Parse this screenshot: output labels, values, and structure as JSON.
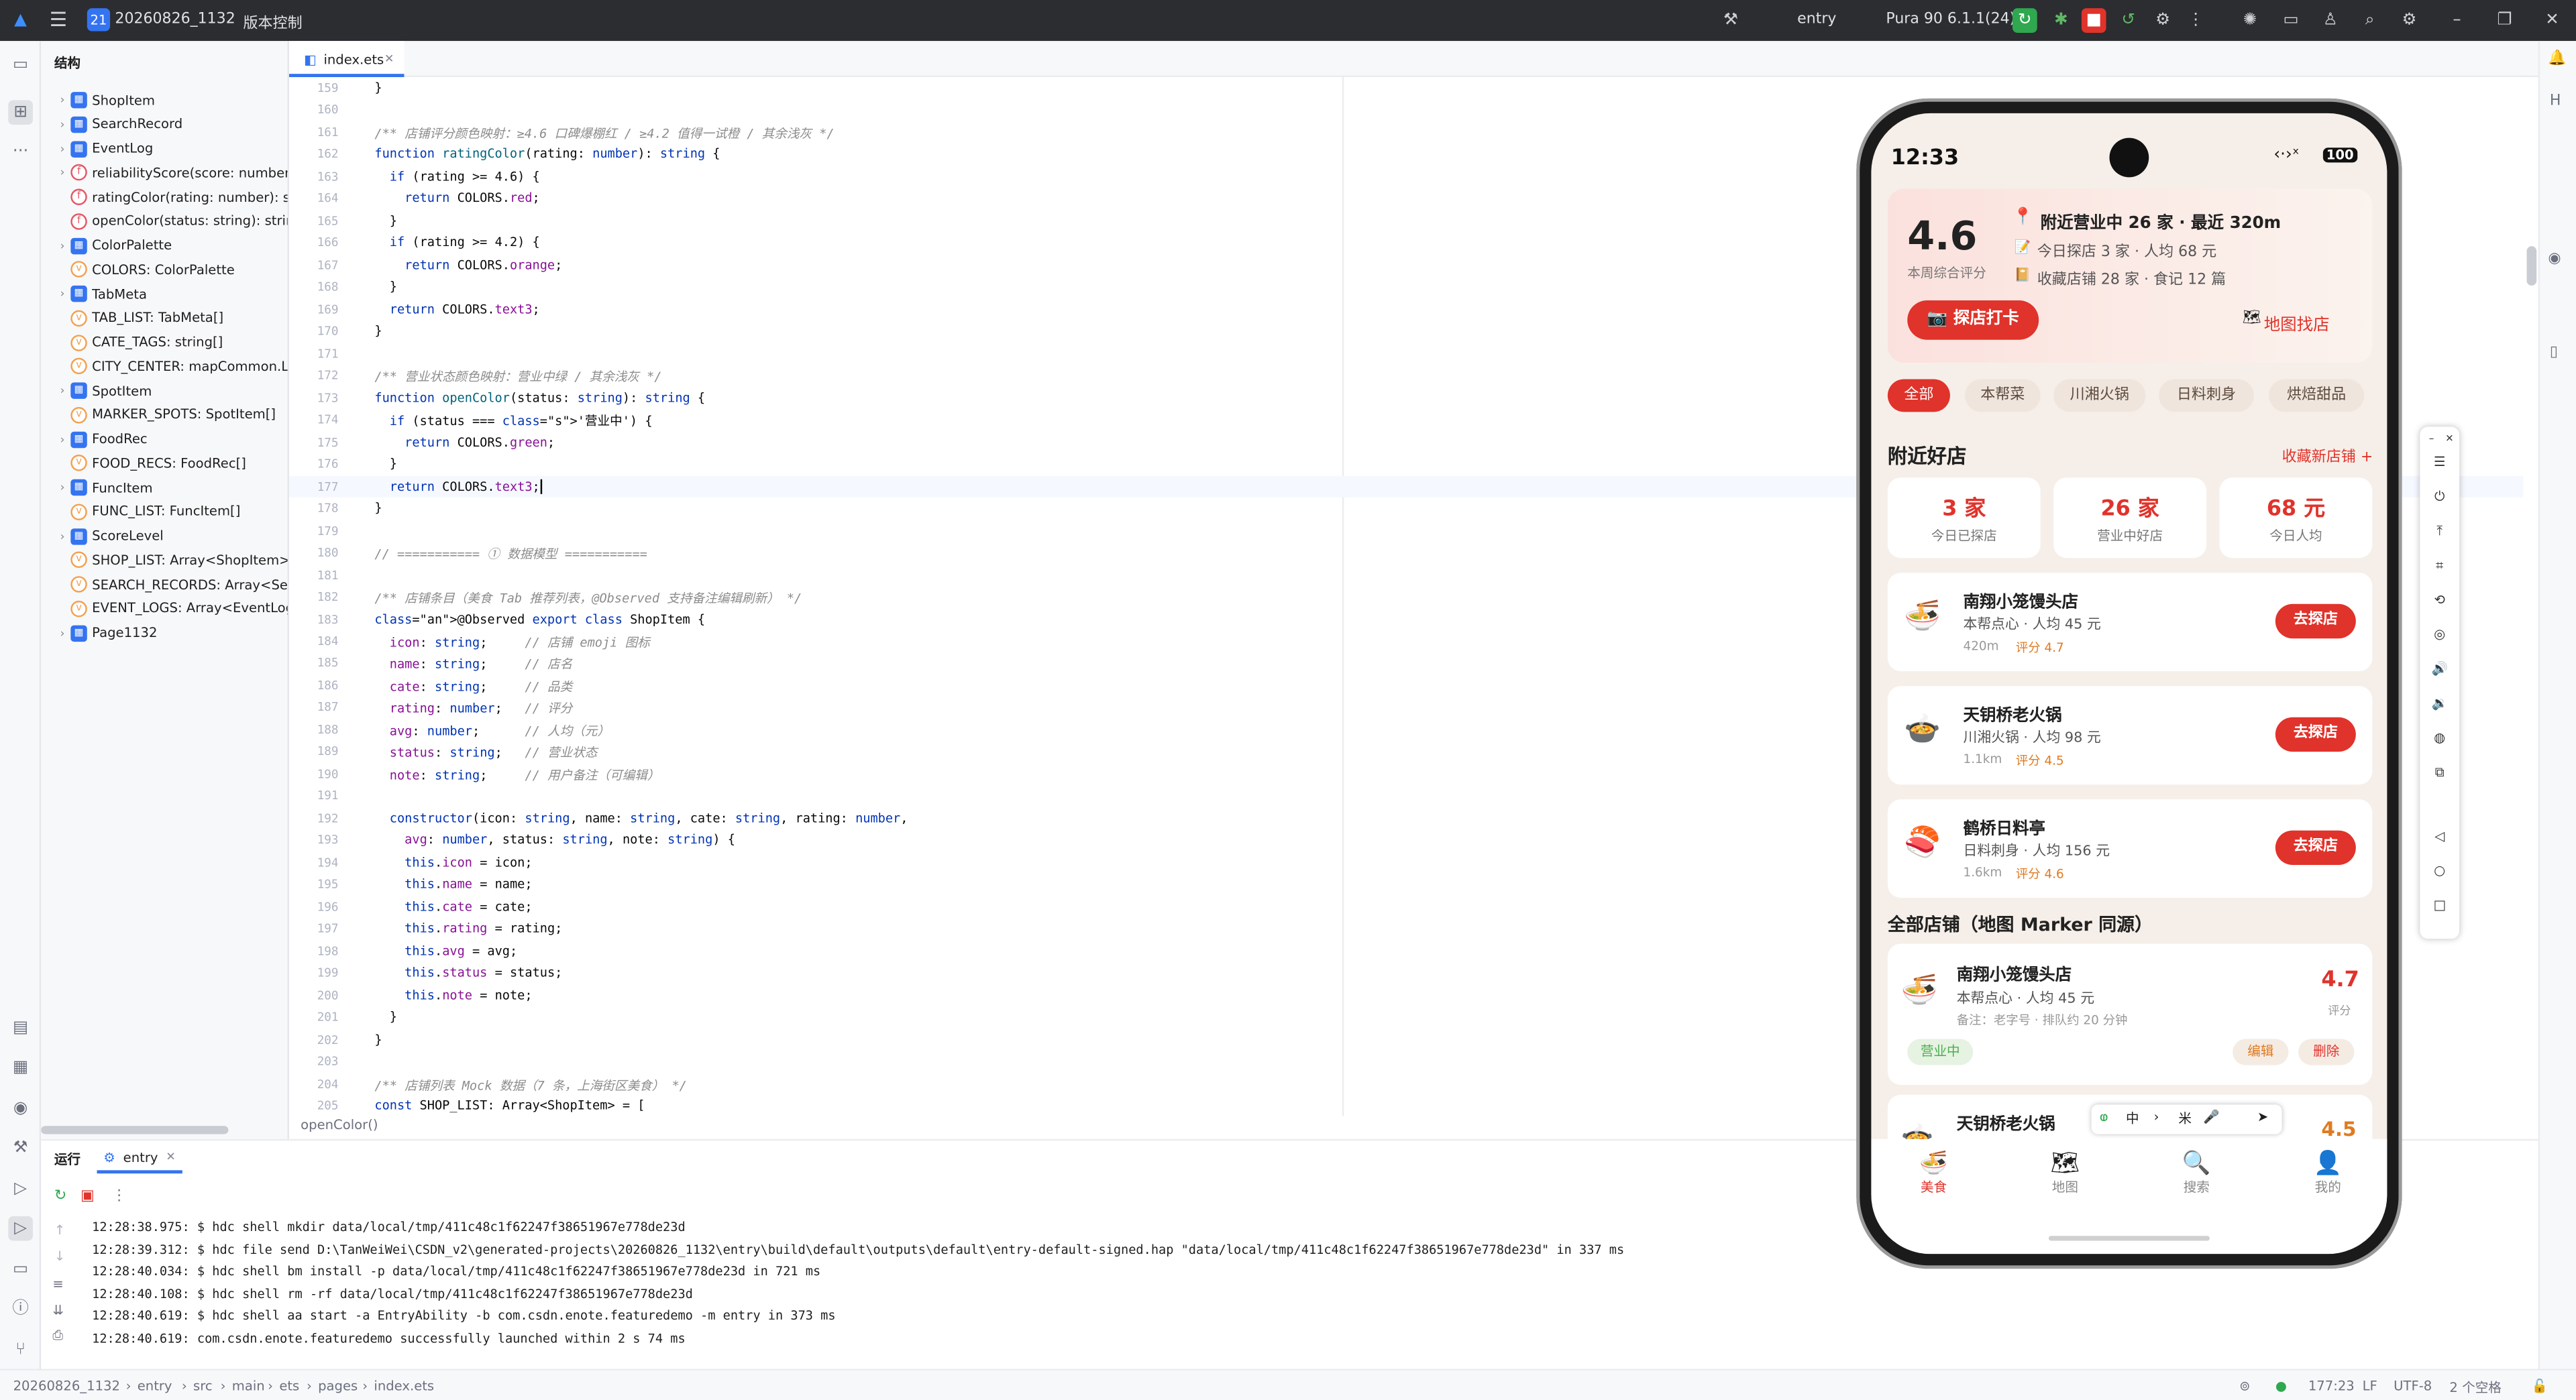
{
  "titlebar": {
    "project_badge": "21",
    "project": "20260826_1132",
    "vcs": "版本控制",
    "module": "entry",
    "device": "Pura 90 6.1.1(24)"
  },
  "structure": {
    "title": "结构",
    "items": [
      {
        "label": "ShopItem",
        "icon": "c"
      },
      {
        "label": "SearchRecord",
        "icon": "c"
      },
      {
        "label": "EventLog",
        "icon": "c"
      },
      {
        "label": "reliabilityScore(score: number):",
        "icon": "f"
      },
      {
        "label": "ratingColor(rating: number): str",
        "icon": "f"
      },
      {
        "label": "openColor(status: string): string",
        "icon": "f"
      },
      {
        "label": "ColorPalette",
        "icon": "c"
      },
      {
        "label": "COLORS: ColorPalette",
        "icon": "v"
      },
      {
        "label": "TabMeta",
        "icon": "c"
      },
      {
        "label": "TAB_LIST: TabMeta[]",
        "icon": "v"
      },
      {
        "label": "CATE_TAGS: string[]",
        "icon": "v"
      },
      {
        "label": "CITY_CENTER: mapCommon.La",
        "icon": "v"
      },
      {
        "label": "SpotItem",
        "icon": "c"
      },
      {
        "label": "MARKER_SPOTS: SpotItem[]",
        "icon": "v"
      },
      {
        "label": "FoodRec",
        "icon": "c"
      },
      {
        "label": "FOOD_RECS: FoodRec[]",
        "icon": "v"
      },
      {
        "label": "FuncItem",
        "icon": "c"
      },
      {
        "label": "FUNC_LIST: FuncItem[]",
        "icon": "v"
      },
      {
        "label": "ScoreLevel",
        "icon": "c"
      },
      {
        "label": "SHOP_LIST: Array<ShopItem>",
        "icon": "v"
      },
      {
        "label": "SEARCH_RECORDS: Array<Sear",
        "icon": "v"
      },
      {
        "label": "EVENT_LOGS: Array<EventLog>",
        "icon": "v"
      },
      {
        "label": "Page1132",
        "icon": "c"
      }
    ]
  },
  "editor": {
    "tab": "index.ets",
    "breadcrumb": "openColor()",
    "warn": "1",
    "code": [
      "}",
      "",
      "/** 店铺评分颜色映射：≥4.6 口碑爆棚红 / ≥4.2 值得一试橙 / 其余浅灰 */",
      "function ratingColor(rating: number): string {",
      "  if (rating >= 4.6) {",
      "    return COLORS.red;",
      "  }",
      "  if (rating >= 4.2) {",
      "    return COLORS.orange;",
      "  }",
      "  return COLORS.text3;",
      "}",
      "",
      "/** 营业状态颜色映射：营业中绿 / 其余浅灰 */",
      "function openColor(status: string): string {",
      "  if (status === '营业中') {",
      "    return COLORS.green;",
      "  }",
      "  return COLORS.text3;",
      "}",
      "",
      "// =========== ① 数据模型 ===========",
      "",
      "/** 店铺条目（美食 Tab 推荐列表，@Observed 支持备注编辑刷新） */",
      "@Observed export class ShopItem {",
      "  icon: string;     // 店铺 emoji 图标",
      "  name: string;     // 店名",
      "  cate: string;     // 品类",
      "  rating: number;   // 评分",
      "  avg: number;      // 人均（元）",
      "  status: string;   // 营业状态",
      "  note: string;     // 用户备注（可编辑）",
      "",
      "  constructor(icon: string, name: string, cate: string, rating: number,",
      "    avg: number, status: string, note: string) {",
      "    this.icon = icon;",
      "    this.name = name;",
      "    this.cate = cate;",
      "    this.rating = rating;",
      "    this.avg = avg;",
      "    this.status = status;",
      "    this.note = note;",
      "  }",
      "}",
      "",
      "/** 店铺列表 Mock 数据（7 条，上海街区美食） */",
      "const SHOP_LIST: Array<ShopItem> = ["
    ],
    "first_line": 159,
    "cursor_line": 177
  },
  "run": {
    "tab1": "运行",
    "tab2": "entry",
    "logs": [
      "12:28:38.975: $ hdc shell mkdir data/local/tmp/411c48c1f62247f38651967e778de23d",
      "12:28:39.312: $ hdc file send D:\\TanWeiWei\\CSDN_v2\\generated-projects\\20260826_1132\\entry\\build\\default\\outputs\\default\\entry-default-signed.hap \"data/local/tmp/411c48c1f62247f38651967e778de23d\" in 337 ms",
      "12:28:40.034: $ hdc shell bm install -p data/local/tmp/411c48c1f62247f38651967e778de23d in 721 ms",
      "12:28:40.108: $ hdc shell rm -rf data/local/tmp/411c48c1f62247f38651967e778de23d",
      "12:28:40.619: $ hdc shell aa start -a EntryAbility -b com.csdn.enote.featuredemo -m entry in 373 ms",
      "12:28:40.619: com.csdn.enote.featuredemo successfully launched within 2 s 74 ms"
    ]
  },
  "statusbar": {
    "crumbs": [
      "20260826_1132",
      "entry",
      "src",
      "main",
      "ets",
      "pages",
      "index.ets"
    ],
    "pos": "177:23",
    "eol": "LF",
    "enc": "UTF-8",
    "indent": "2 个空格"
  },
  "phone": {
    "time": "12:33",
    "battery": "100",
    "hero": {
      "score": "4.6",
      "score_label": "本周综合评分",
      "line1": "附近营业中 26 家 · 最近 320m",
      "line2": "今日探店 3 家 · 人均 68 元",
      "line3": "收藏店铺 28 家 · 食记 12 篇",
      "checkin": "📷 探店打卡",
      "map": "地图找店"
    },
    "chips": [
      "全部",
      "本帮菜",
      "川湘火锅",
      "日料刺身",
      "烘焙甜品"
    ],
    "section1": "附近好店",
    "section1_link": "收藏新店铺 +",
    "stats": [
      {
        "v": "3 家",
        "l": "今日已探店"
      },
      {
        "v": "26 家",
        "l": "营业中好店"
      },
      {
        "v": "68 元",
        "l": "今日人均"
      }
    ],
    "shops": [
      {
        "icon": "🍜",
        "name": "南翔小笼馒头店",
        "sub": "本帮点心 · 人均 45 元",
        "dist": "420m",
        "score": "评分 4.7",
        "btn": "去探店"
      },
      {
        "icon": "🍲",
        "name": "天钥桥老火锅",
        "sub": "川湘火锅 · 人均 98 元",
        "dist": "1.1km",
        "score": "评分 4.5",
        "btn": "去探店"
      },
      {
        "icon": "🍣",
        "name": "鹤桥日料亭",
        "sub": "日料刺身 · 人均 156 元",
        "dist": "1.6km",
        "score": "评分 4.6",
        "btn": "去探店"
      }
    ],
    "section2": "全部店铺（地图 Marker 同源）",
    "all": [
      {
        "icon": "🍜",
        "name": "南翔小笼馒头店",
        "sub": "本帮点心 · 人均 45 元",
        "note": "备注：老字号 · 排队约 20 分钟",
        "rating": "4.7",
        "rating_label": "评分",
        "status": "营业中",
        "edit": "编辑",
        "del": "删除"
      },
      {
        "icon": "🍲",
        "name": "天钥桥老火锅",
        "rating": "4.5"
      }
    ],
    "tabs": [
      {
        "icon": "🍜",
        "label": "美食"
      },
      {
        "icon": "🗺",
        "label": "地图"
      },
      {
        "icon": "🔍",
        "label": "搜索"
      },
      {
        "icon": "👤",
        "label": "我的"
      }
    ],
    "ime": [
      "中",
      "›",
      "米",
      "🎤"
    ]
  },
  "colors": {
    "accent": "#e0332b",
    "green": "#4caf50",
    "orange": "#e07a1f"
  }
}
